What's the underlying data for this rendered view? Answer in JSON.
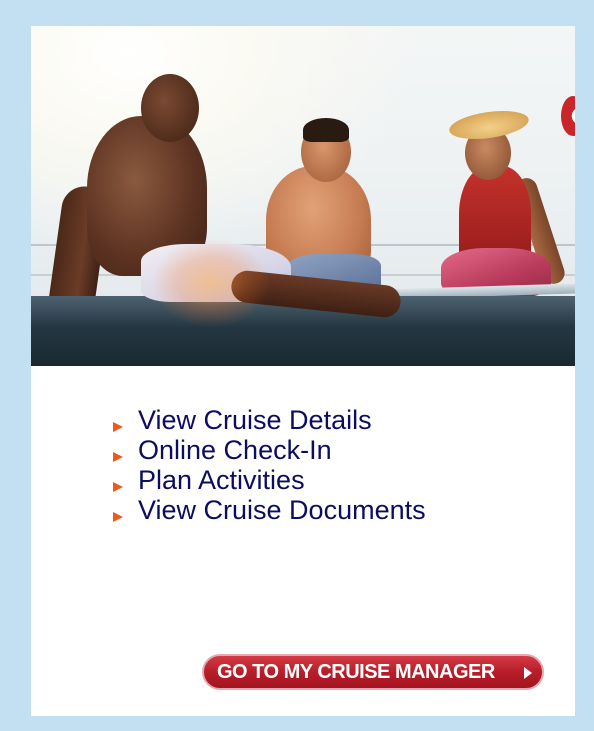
{
  "hero": {
    "icon": "beach-deck-photo"
  },
  "links": [
    {
      "label": "View Cruise Details",
      "icon": "orange-triangle-bullet"
    },
    {
      "label": "Online Check-In",
      "icon": "orange-triangle-bullet"
    },
    {
      "label": "Plan Activities",
      "icon": "orange-triangle-bullet"
    },
    {
      "label": "View Cruise Documents",
      "icon": "orange-triangle-bullet"
    }
  ],
  "cta": {
    "label": "GO TO MY CRUISE MANAGER",
    "icon": "chevron-right-icon"
  },
  "colors": {
    "page_background": "#c3dff2",
    "panel_background": "#ffffff",
    "link_text": "#0d0d60",
    "bullet": "#ee5a1c",
    "cta_background": "#b81e2a",
    "cta_text": "#ffffff"
  }
}
